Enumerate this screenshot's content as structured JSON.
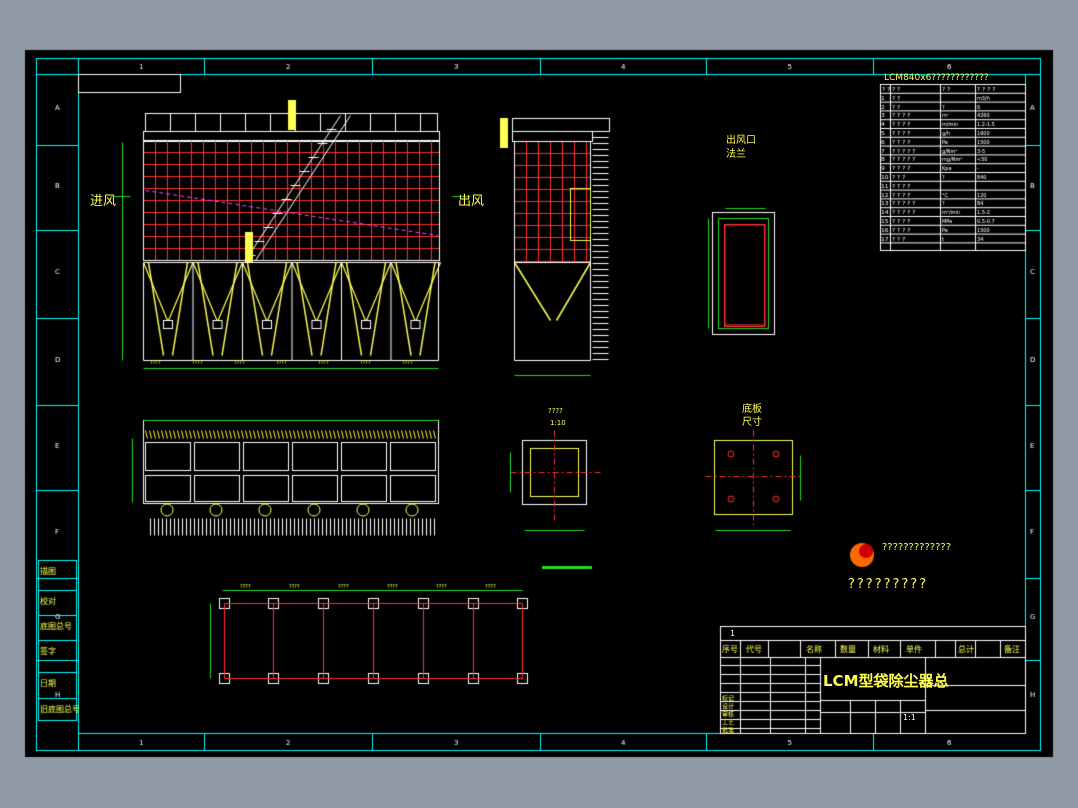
{
  "drawing": {
    "border_columns": [
      "1",
      "2",
      "3",
      "4",
      "5",
      "6"
    ],
    "border_rows": [
      "A",
      "B",
      "C",
      "D",
      "E",
      "F",
      "G",
      "H"
    ],
    "param_table": {
      "title": "LCM840x6????????????",
      "header": [
        "? ?",
        "? ?",
        "? ?",
        "? ? ? ?"
      ],
      "rows": [
        [
          "1",
          "? ?",
          "",
          "m3/h"
        ],
        [
          "2",
          "? ?",
          "?",
          "6"
        ],
        [
          "3",
          "? ? ? ?",
          "m²",
          "4260"
        ],
        [
          "4",
          "? ? ? ?",
          "m/min",
          "1.2-1.5"
        ],
        [
          "5",
          "? ? ? ?",
          "g/h",
          "1600"
        ],
        [
          "6",
          "? ? ? ?",
          "Pa",
          "1500"
        ],
        [
          "7",
          "? ? ? ? ?",
          "g/Nm³",
          "3-5"
        ],
        [
          "8",
          "? ? ? ? ?",
          "mg/Nm³",
          "<50"
        ],
        [
          "9",
          "? ? ? ?",
          "Kpa",
          "-"
        ],
        [
          "10",
          "? ? ?",
          "?",
          "840"
        ],
        [
          "11",
          "? ? ? ?",
          "",
          ""
        ],
        [
          "12",
          "? ? ? ?",
          "°C",
          "120"
        ],
        [
          "13",
          "? ? ? ? ?",
          "?",
          "84"
        ],
        [
          "14",
          "? ? ? ? ?",
          "m³/min",
          "1.5-2"
        ],
        [
          "15",
          "? ? ? ?",
          "MPa",
          "0.5-0.7"
        ],
        [
          "16",
          "? ? ? ?",
          "Pa",
          "1500"
        ],
        [
          "17",
          "? ? ?",
          "t",
          "34"
        ]
      ]
    },
    "labels": {
      "inlet": "进风",
      "outlet": "出风",
      "outlet_flange": "出风口法兰",
      "base_plate": "底板尺寸",
      "detail_title": "????",
      "detail_scale": "1:10",
      "logo_line1": "?????????????",
      "logo_line2": "?????????",
      "title_block_title": "LCM型袋除尘器总",
      "title_block_sheet": "1",
      "title_block_scale": "1:1"
    },
    "title_block": {
      "headers": [
        "序号",
        "代号",
        "名称",
        "数量",
        "材料",
        "单件",
        "总计",
        "备注"
      ],
      "left_labels": [
        "标记",
        "设计",
        "审核",
        "工艺",
        "批准"
      ]
    },
    "side_boxes": [
      "描图",
      "校对",
      "底图总号",
      "签字",
      "日期",
      "旧底图总号"
    ],
    "colors": {
      "background": "#000000",
      "frame": "#00ffff",
      "grid_red": "#ff3030",
      "yellow": "#ffff55",
      "green": "#22dd22",
      "white": "#ffffff",
      "magenta": "#ff44ff"
    }
  }
}
